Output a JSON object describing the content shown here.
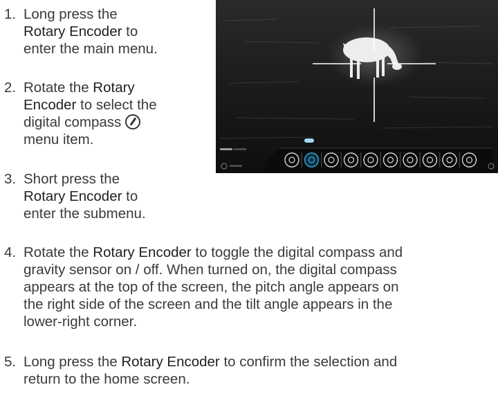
{
  "steps": [
    {
      "num": "1.",
      "lines": [
        [
          "Long press the"
        ],
        [
          "",
          "Rotary Encoder",
          " to"
        ],
        [
          "enter the main menu."
        ]
      ]
    },
    {
      "num": "2.",
      "lines": [
        [
          "Rotate the ",
          "Rotary"
        ],
        [
          "",
          "Encoder",
          " to select the"
        ],
        [
          "digital compass "
        ],
        [
          "menu item."
        ]
      ]
    },
    {
      "num": "3.",
      "lines": [
        [
          "Short press the"
        ],
        [
          "",
          "Rotary Encoder",
          " to"
        ],
        [
          "enter the submenu."
        ]
      ]
    },
    {
      "num": "4.",
      "lines": [
        [
          "Rotate the ",
          "Rotary Encoder",
          " to toggle the digital compass and"
        ],
        [
          "gravity sensor on / off. When turned on, the digital compass"
        ],
        [
          "appears at the top of the screen, the pitch angle appears on"
        ],
        [
          "the right side of the screen and the tilt angle appears in the"
        ],
        [
          "lower-right corner."
        ]
      ]
    },
    {
      "num": "5.",
      "lines": [
        [
          "Long press the ",
          "Rotary Encoder",
          " to confirm the selection and"
        ],
        [
          "return to the home screen."
        ]
      ]
    }
  ],
  "screen": {
    "menu_icons": [
      "wifi-icon",
      "compass-icon",
      "microphone-icon",
      "night-mode-icon",
      "camera-icon",
      "color-palette-icon",
      "reticle-cross-icon",
      "reticle-icon",
      "gallery-icon",
      "settings-icon"
    ],
    "selected_icon": "compass-icon",
    "accent": "#3aa7e0"
  }
}
